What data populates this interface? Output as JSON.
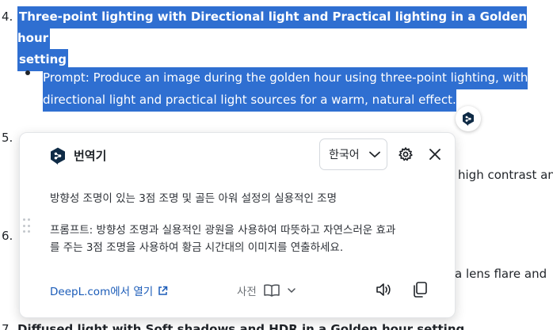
{
  "document": {
    "item4": {
      "number": "4.",
      "title_line1": "Three-point lighting with Directional light and Practical lighting in a Golden hour",
      "title_line2": "setting",
      "prompt_line1": "Prompt: Produce an image during the golden hour using three-point lighting, with",
      "prompt_line2": "directional light and practical light sources for a warm, natural effect."
    },
    "item5": {
      "number": "5.",
      "visible_fragment": "high contrast and"
    },
    "item6": {
      "number": "6.",
      "visible_fragment": "a lens flare and"
    },
    "item7": {
      "number": "7.",
      "visible_fragment": "Diffused light with Soft shadows and HDR in a Golden hour setting"
    }
  },
  "translator": {
    "title": "번역기",
    "language": "한국어",
    "translation_line1": "방향성 조명이 있는 3점 조명 및 골든 아워 설정의 실용적인 조명",
    "translation_line2": "프롬프트: 방향성 조명과 실용적인 광원을 사용하여 따뜻하고 자연스러운 효과",
    "translation_line3": "를 주는 3점 조명을 사용하여 황금 시간대의 이미지를 연출하세요.",
    "open_link": "DeepL.com에서 열기",
    "dictionary_label": "사전"
  },
  "colors": {
    "selection": "#2f6fd1",
    "deepl_logo": "#0f2b46",
    "link": "#1a5bb8"
  }
}
